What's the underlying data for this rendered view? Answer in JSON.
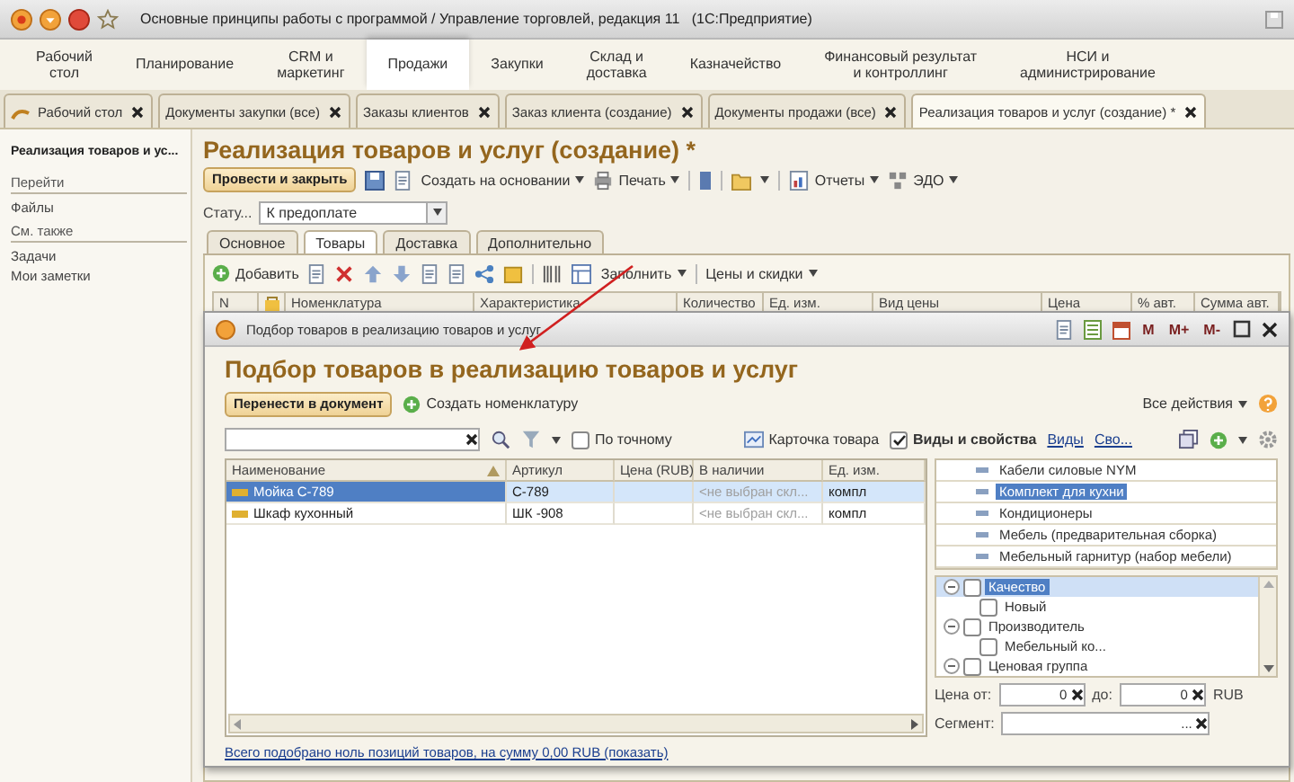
{
  "window": {
    "title": "Основные принципы работы с программой / Управление торговлей, редакция 11   (1С:Предприятие)"
  },
  "sections": [
    {
      "label": "Рабочий\nстол",
      "selected": false
    },
    {
      "label": "Планирование",
      "selected": false
    },
    {
      "label": "CRM и\nмаркетинг",
      "selected": false
    },
    {
      "label": "Продажи",
      "selected": true
    },
    {
      "label": "Закупки",
      "selected": false
    },
    {
      "label": "Склад и\nдоставка",
      "selected": false
    },
    {
      "label": "Казначейство",
      "selected": false
    },
    {
      "label": "Финансовый результат\nи контроллинг",
      "selected": false
    },
    {
      "label": "НСИ и\nадминистрирование",
      "selected": false
    }
  ],
  "open_tabs": [
    {
      "label": "Рабочий стол",
      "selected": false,
      "kind": "home"
    },
    {
      "label": "Документы закупки (все)",
      "selected": false,
      "kind": "doc"
    },
    {
      "label": "Заказы клиентов",
      "selected": false,
      "kind": "doc"
    },
    {
      "label": "Заказ клиента (создание)",
      "selected": false,
      "kind": "doc"
    },
    {
      "label": "Документы продажи (все)",
      "selected": false,
      "kind": "doc"
    },
    {
      "label": "Реализация товаров и услуг (создание) *",
      "selected": true,
      "kind": "doc"
    }
  ],
  "sidebar": {
    "title": "Реализация товаров и ус...",
    "groups": [
      {
        "heading": "Перейти",
        "items": [
          "Файлы"
        ]
      },
      {
        "heading": "См. также",
        "items": [
          "Задачи",
          "Мои заметки"
        ]
      }
    ]
  },
  "document": {
    "title": "Реализация товаров и услуг (создание) *",
    "toolbar": {
      "post": "Провести и закрыть",
      "create_based": "Создать на основании",
      "print": "Печать",
      "reports": "Отчеты",
      "edo": "ЭДО"
    },
    "status_label": "Стату...",
    "status_value": "К предоплате",
    "tabs": [
      {
        "label": "Основное",
        "selected": false
      },
      {
        "label": "Товары",
        "selected": true
      },
      {
        "label": "Доставка",
        "selected": false
      },
      {
        "label": "Дополнительно",
        "selected": false
      }
    ],
    "table_toolbar": {
      "add": "Добавить",
      "fill": "Заполнить",
      "prices": "Цены и скидки"
    },
    "columns": [
      "N",
      "Номенклатура",
      "Характеристика",
      "Количество",
      "Ед. изм.",
      "Вид цены",
      "Цена",
      "% авт.",
      "Сумма авт."
    ]
  },
  "dialog": {
    "title": "Подбор товаров в реализацию товаров и услуг",
    "memory_buttons": [
      "M",
      "M+",
      "M-"
    ],
    "heading": "Подбор товаров в реализацию товаров и услуг",
    "transfer": "Перенести в документ",
    "create": "Создать номенклатуру",
    "all_actions": "Все действия",
    "exact": {
      "label": "По точному",
      "checked": false
    },
    "card": "Карточка товара",
    "kinds": {
      "label": "Виды и свойства",
      "checked": true
    },
    "links": [
      "Виды",
      "Сво..."
    ],
    "columns": [
      "Наименование",
      "Артикул",
      "Цена (RUB)",
      "В наличии",
      "Ед. изм."
    ],
    "rows": [
      {
        "name": "Мойка С-789",
        "article": "С-789",
        "stock": "<не выбран скл...",
        "unit": "компл",
        "selected": true
      },
      {
        "name": "Шкаф кухонный",
        "article": "ШК -908",
        "stock": "<не выбран скл...",
        "unit": "компл",
        "selected": false
      }
    ],
    "categories": [
      {
        "label": "Кабели силовые NYM",
        "selected": false
      },
      {
        "label": "Комплект для кухни",
        "selected": true
      },
      {
        "label": "Кондиционеры",
        "selected": false
      },
      {
        "label": "Мебель (предварительная сборка)",
        "selected": false
      },
      {
        "label": "Мебельный гарнитур (набор мебели)",
        "selected": false
      }
    ],
    "properties": [
      {
        "label": "Качество",
        "checked": false,
        "selected": true,
        "expanded": true,
        "children": [
          {
            "label": "Новый",
            "checked": false,
            "selected": false
          }
        ]
      },
      {
        "label": "Производитель",
        "checked": false,
        "selected": false,
        "expanded": true,
        "children": [
          {
            "label": "Мебельный ко...",
            "checked": false,
            "selected": false
          }
        ]
      },
      {
        "label": "Ценовая группа",
        "checked": false,
        "selected": false,
        "expanded": true
      }
    ],
    "price_from_label": "Цена от:",
    "price_from": "0",
    "price_to_label": "до:",
    "price_to": "0",
    "currency": "RUB",
    "segment_label": "Сегмент:",
    "segment_dots": "...",
    "footer": "Всего подобрано ноль позиций товаров, на сумму 0,00 RUB (показать)"
  }
}
